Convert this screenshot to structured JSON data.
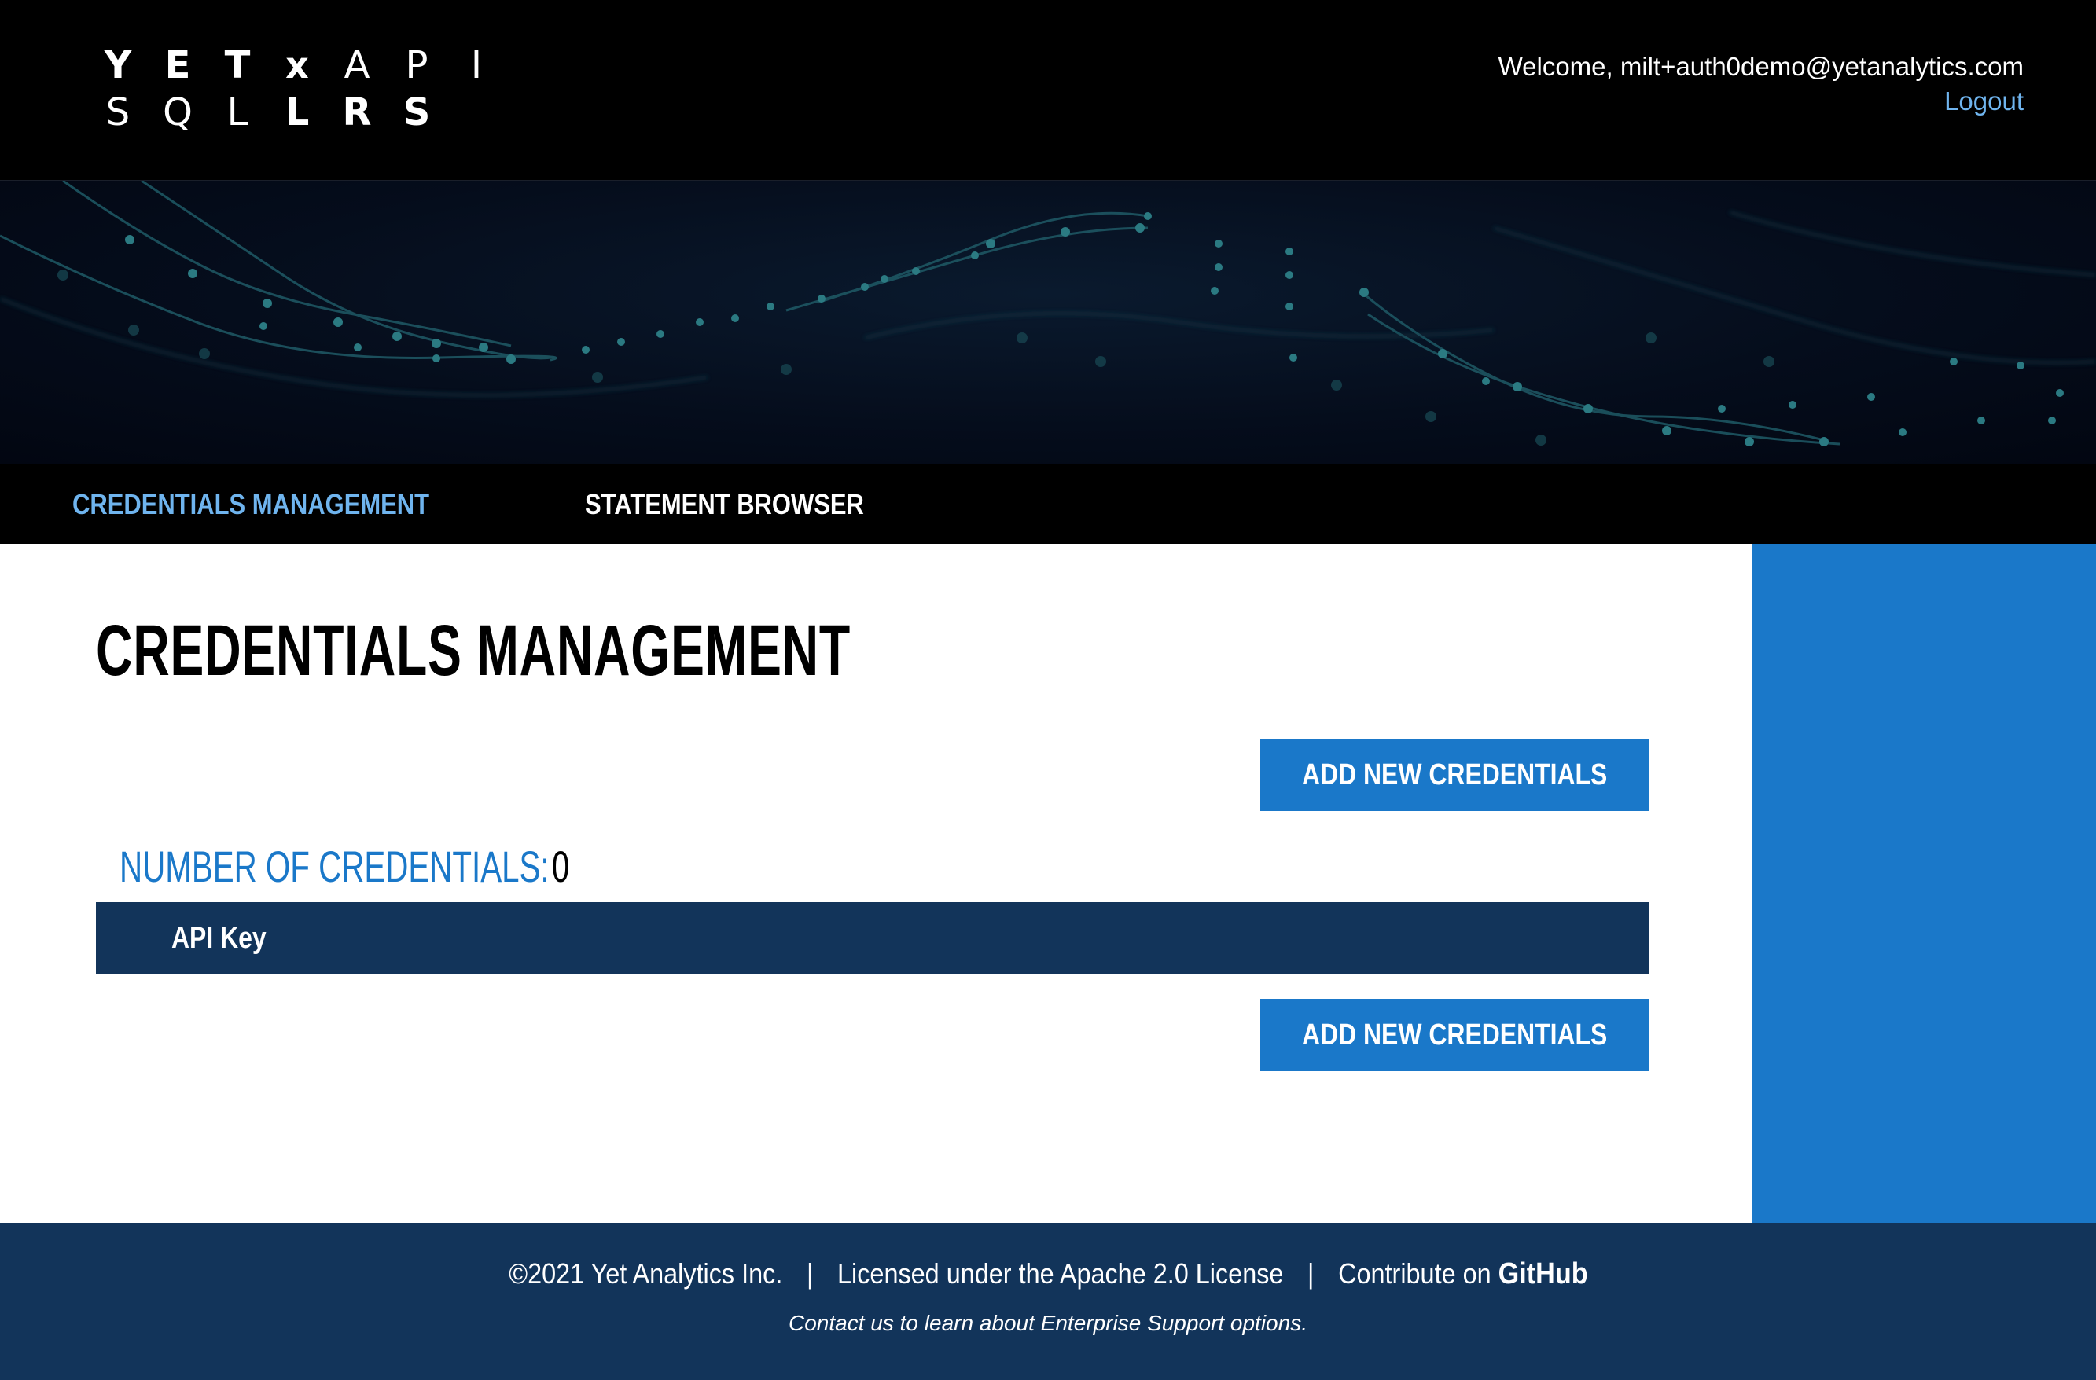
{
  "header": {
    "logo": {
      "row1": [
        "Y",
        "E",
        "T",
        "x",
        "A",
        "P",
        "I"
      ],
      "row2": [
        "S",
        "Q",
        "L",
        "L",
        "R",
        "S"
      ]
    },
    "welcome_text": "Welcome, milt+auth0demo@yetanalytics.com",
    "logout_label": "Logout"
  },
  "nav": {
    "tabs": [
      {
        "label": "CREDENTIALS MANAGEMENT",
        "active": true
      },
      {
        "label": "STATEMENT BROWSER",
        "active": false
      }
    ]
  },
  "main": {
    "title": "CREDENTIALS MANAGEMENT",
    "add_button_label": "ADD NEW CREDENTIALS",
    "count_label": "NUMBER OF CREDENTIALS:",
    "count_value": "0",
    "table": {
      "columns": [
        "API Key"
      ],
      "rows": []
    }
  },
  "footer": {
    "copyright": "©2021 Yet Analytics Inc.",
    "separator": "|",
    "license": "Licensed under the Apache 2.0 License",
    "contribute": "Contribute on",
    "github": "GitHub",
    "enterprise": "Contact us to learn about Enterprise Support options."
  },
  "colors": {
    "accent": "#1a78c9",
    "accent_light": "#6fb4ee",
    "navy": "#12345a",
    "black": "#000000"
  }
}
